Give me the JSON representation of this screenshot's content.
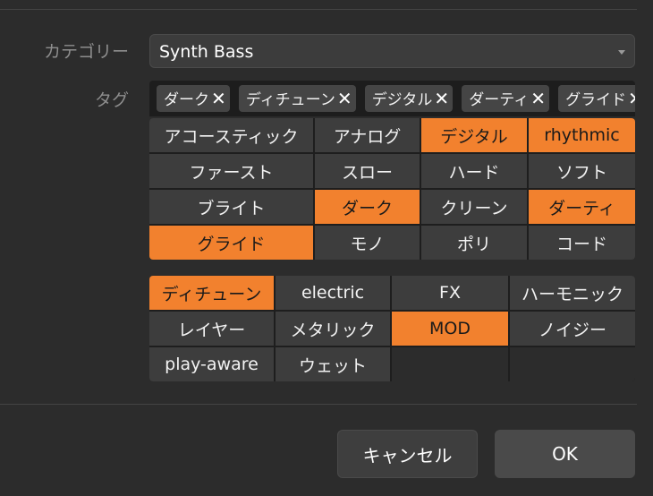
{
  "category": {
    "label": "カテゴリー",
    "value": "Synth Bass",
    "arrow_icon": "chevron-down-icon"
  },
  "tags": {
    "label": "タグ",
    "selected": [
      "ダーク",
      "ディチューン",
      "デジタル",
      "ダーティ",
      "グライド"
    ],
    "remove_glyph": "✕"
  },
  "grid1": [
    {
      "label": "アコースティック",
      "active": false
    },
    {
      "label": "アナログ",
      "active": false
    },
    {
      "label": "デジタル",
      "active": true
    },
    {
      "label": "rhythmic",
      "active": true
    },
    {
      "label": "ファースト",
      "active": false
    },
    {
      "label": "スロー",
      "active": false
    },
    {
      "label": "ハード",
      "active": false
    },
    {
      "label": "ソフト",
      "active": false
    },
    {
      "label": "ブライト",
      "active": false
    },
    {
      "label": "ダーク",
      "active": true
    },
    {
      "label": "クリーン",
      "active": false
    },
    {
      "label": "ダーティ",
      "active": true
    },
    {
      "label": "グライド",
      "active": true
    },
    {
      "label": "モノ",
      "active": false
    },
    {
      "label": "ポリ",
      "active": false
    },
    {
      "label": "コード",
      "active": false
    }
  ],
  "grid2": [
    {
      "label": "ディチューン",
      "active": true
    },
    {
      "label": "electric",
      "active": false
    },
    {
      "label": "FX",
      "active": false
    },
    {
      "label": "ハーモニック",
      "active": false
    },
    {
      "label": "レイヤー",
      "active": false
    },
    {
      "label": "メタリック",
      "active": false
    },
    {
      "label": "MOD",
      "active": true
    },
    {
      "label": "ノイジー",
      "active": false
    },
    {
      "label": "play-aware",
      "active": false
    },
    {
      "label": "ウェット",
      "active": false
    }
  ],
  "actions": {
    "cancel": "キャンセル",
    "ok": "OK"
  },
  "colors": {
    "accent": "#f2812e",
    "background": "#2c2c2c",
    "button": "#3d3d3d"
  }
}
